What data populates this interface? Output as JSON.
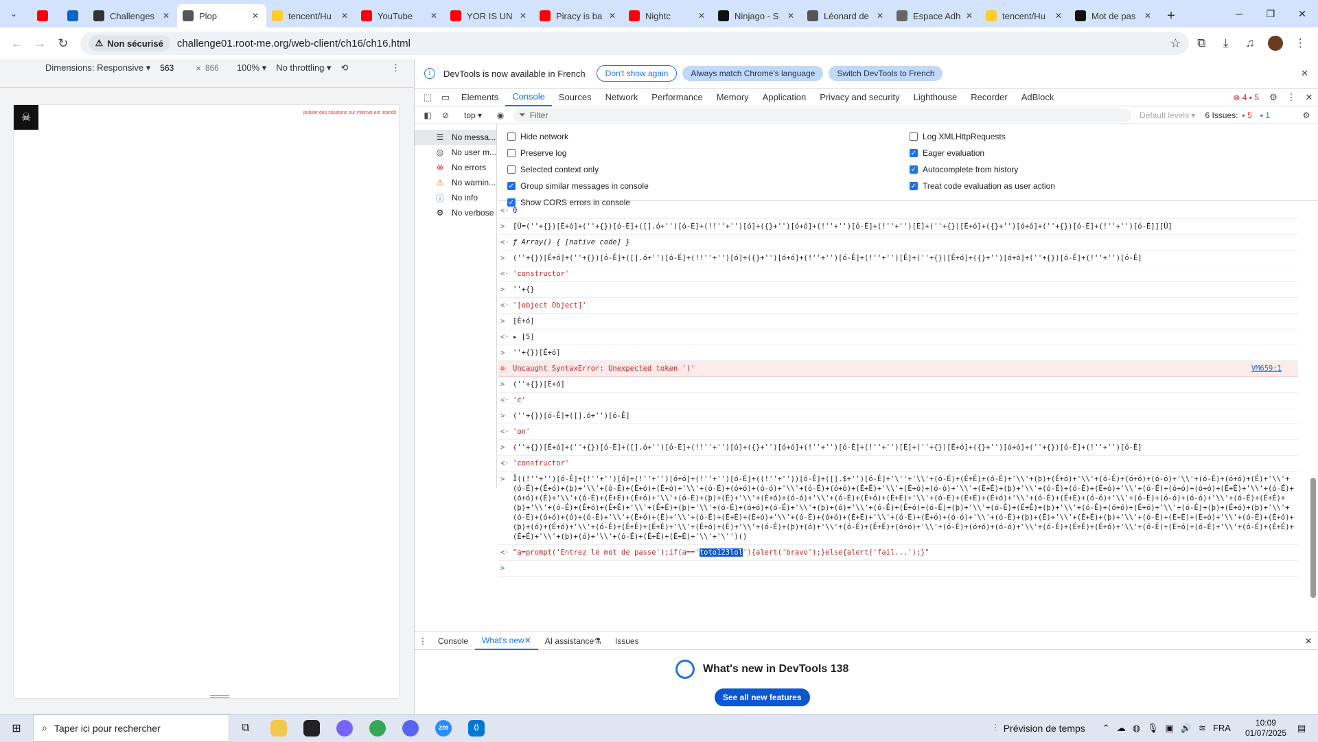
{
  "tabs": [
    {
      "label": "",
      "icon": "youtube-icon",
      "color": "#ff0000",
      "pinned": true
    },
    {
      "label": "",
      "icon": "outlook-icon",
      "color": "#0a64c9",
      "pinned": true
    },
    {
      "label": "Challenges",
      "icon": "root-me-icon",
      "color": "#333333"
    },
    {
      "label": "Plop",
      "icon": "globe-icon",
      "color": "#555555",
      "active": true
    },
    {
      "label": "tencent/Hu",
      "icon": "huggingface-icon",
      "color": "#ffcc33"
    },
    {
      "label": "YouTube",
      "icon": "youtube-icon",
      "color": "#ff0000"
    },
    {
      "label": "YOR IS UN",
      "icon": "youtube-icon",
      "color": "#ff0000"
    },
    {
      "label": "Piracy is ba",
      "icon": "youtube-icon",
      "color": "#ff0000"
    },
    {
      "label": "Nightc",
      "icon": "youtube-icon",
      "color": "#ff0000"
    },
    {
      "label": "Ninjago - S",
      "icon": "tiktok-icon",
      "color": "#111111"
    },
    {
      "label": "Léonard de",
      "icon": "wikipedia-icon",
      "color": "#555555"
    },
    {
      "label": "Espace Adh",
      "icon": "document-icon",
      "color": "#666666"
    },
    {
      "label": "tencent/Hu",
      "icon": "huggingface-icon",
      "color": "#ffcc33"
    },
    {
      "label": "Mot de pas",
      "icon": "openai-icon",
      "color": "#111111"
    }
  ],
  "toolbar": {
    "security_label": "Non sécurisé",
    "url": "challenge01.root-me.org/web-client/ch16/ch16.html"
  },
  "devicebar": {
    "dimensions": "Dimensions: Responsive",
    "width": "563",
    "height": "866",
    "zoom": "100%",
    "throttle": "No throttling"
  },
  "page": {
    "slogan": "publier des solutions sur internet est interdit"
  },
  "devtools": {
    "infobar": {
      "message": "DevTools is now available in French",
      "dont_show": "Don't show again",
      "always_match": "Always match Chrome's language",
      "switch": "Switch DevTools to French"
    },
    "tabs": [
      "Elements",
      "Console",
      "Sources",
      "Network",
      "Performance",
      "Memory",
      "Application",
      "Privacy and security",
      "Lighthouse",
      "Recorder",
      "AdBlock"
    ],
    "error_count": "4",
    "warning_count": "5",
    "context": "top",
    "filter_placeholder": "Filter",
    "levels": "Default levels",
    "issues_label": "6 Issues:",
    "issues_red": "5",
    "issues_blue": "1",
    "sidebar": [
      {
        "label": "No messa...",
        "icon": "list-icon"
      },
      {
        "label": "No user m...",
        "icon": "user-icon"
      },
      {
        "label": "No errors",
        "icon": "error-icon"
      },
      {
        "label": "No warnin...",
        "icon": "warning-icon"
      },
      {
        "label": "No info",
        "icon": "info-icon"
      },
      {
        "label": "No verbose",
        "icon": "gear-icon"
      }
    ],
    "settings_left": [
      {
        "label": "Hide network",
        "checked": false
      },
      {
        "label": "Preserve log",
        "checked": false
      },
      {
        "label": "Selected context only",
        "checked": false
      },
      {
        "label": "Group similar messages in console",
        "checked": true
      },
      {
        "label": "Show CORS errors in console",
        "checked": true
      }
    ],
    "settings_right": [
      {
        "label": "Log XMLHttpRequests",
        "checked": false
      },
      {
        "label": "Eager evaluation",
        "checked": true
      },
      {
        "label": "Autocomplete from history",
        "checked": true
      },
      {
        "label": "Treat code evaluation as user action",
        "checked": true
      }
    ],
    "console": [
      {
        "kind": "num",
        "arrow": "<·",
        "text": "0"
      },
      {
        "kind": "input",
        "arrow": ">",
        "text": "[Û=(''+{})[É+ó]+(''+{})[ó-É]+([].ó+'')[ó-É]+(!!''+'')[ó]+({}+'')[ó+ó]+(!''+'')[ó-É]+(!''+'')[É]+(''+{})[É+ó]+({}+'')[ó+ó]+(''+{})[ó-É]+(!''+'')[ó-É]][Û]"
      },
      {
        "kind": "fn",
        "arrow": "<·",
        "text": "ƒ Array() { [native code] }"
      },
      {
        "kind": "input",
        "arrow": ">",
        "text": "(''+{})[É+ó]+(''+{})[ó-É]+([].ó+'')[ó-É]+(!!''+'')[ó]+({}+'')[ó+ó]+(!''+'')[ó-É]+(!''+'')[É]+(''+{})[É+ó]+({}+'')[ó+ó]+(''+{})[ó-É]+(!''+'')[ó-É]"
      },
      {
        "kind": "str",
        "arrow": "<·",
        "text": "'constructor'"
      },
      {
        "kind": "input",
        "arrow": ">",
        "text": "''+{}"
      },
      {
        "kind": "str",
        "arrow": "<·",
        "text": "'[object Object]'"
      },
      {
        "kind": "input",
        "arrow": ">",
        "text": "[É+ó]"
      },
      {
        "kind": "result",
        "arrow": "<·",
        "text": "▸ [5]"
      },
      {
        "kind": "input",
        "arrow": ">",
        "text": "''+{})[É+ó]"
      },
      {
        "kind": "err",
        "arrow": "⊗",
        "text": "Uncaught SyntaxError: Unexpected token ')'",
        "source": "VM659:1"
      },
      {
        "kind": "input",
        "arrow": ">",
        "text": "(''+{})[É+ó]"
      },
      {
        "kind": "str",
        "arrow": "<·",
        "text": "'c'"
      },
      {
        "kind": "input",
        "arrow": ">",
        "text": "(''+{})[ó-É]+([].ó+'')[ó-É]"
      },
      {
        "kind": "str",
        "arrow": "<·",
        "text": "'on'"
      },
      {
        "kind": "input",
        "arrow": ">",
        "text": "(''+{})[É+ó]+(''+{})[ó-É]+([].ó+'')[ó-É]+(!!''+'')[ó]+({}+'')[ó+ó]+(!''+'')[ó-É]+(!''+'')[É]+(''+{})[É+ó]+({}+'')[ó+ó]+(''+{})[ó-É]+(!''+'')[ó-É]"
      },
      {
        "kind": "str",
        "arrow": "<·",
        "text": "'constructor'"
      },
      {
        "kind": "input",
        "arrow": ">",
        "text": "Î((!''+'')[ó-É]+(!''+'')[ó]+(!''+'')[ó+ó]+(!''+'')[ó-É]+((!''+''))[ó-É]+([].$+'')[ó-É]+'\\''+'\\\\'+(ó-É)+(É+É)+(ó-É)+'\\\\'+(þ)+(É+ó)+'\\\\'+(ó-É)+(ó+ó)+(ó-ó)+'\\\\'+(ó-É)+(ó+ó)+(É)+'\\\\'+(ó-É)+(É+ó)+(þ)+'\\\\'+(ó-É)+(É+ó)+(É+ó)+'\\\\'+(ó-É)+(ó+ó)+(ó-ó)+'\\\\'+(ó-É)+(ó+ó)+(É+É)+'\\\\'+(É+ó)+(ó-ó)+'\\\\'+(É+É)+(þ)+'\\\\'+(ó-É)+(ó-É)+(É+ó)+'\\\\'+(ó-É)+(ó+ó)+(ó+ó)+(É+É)+'\\\\'+(ó-É)+(ó+ó)+(É)+'\\\\'+(ó-É)+(É+É)+(É+ó)+'\\\\'+(ó-É)+(þ)+(É)+'\\\\'+(É+ó)+(ó-ó)+'\\\\'+(ó-É)+(É+ó)+(É+É)+'\\\\'+(ó-É)+(É+É)+(É+ó)+'\\\\'+(ó-É)+(É+É)+(ó-ó)+'\\\\'+(ó-É)+(ó-ó)+(ó-ó)+'\\\\'+(ó-É)+(É+É)+(þ)+'\\\\'+(ó-É)+(É+ó)+(É+É)+'\\\\'+(É+É)+(þ)+'\\\\'+(ó-É)+(ó+ó)+(ó-É)+'\\\\'+(þ)+(ó)+'\\\\'+(ó-É)+(É+ó)+(ó-É)+(þ)+'\\\\'+(ó-É)+(É+É)+(þ)+'\\\\'+(ó-É)+(ó+ó)+(É+ó)+'\\\\'+(ó-É)+(þ)+(É+ó)+(þ)+'\\\\'+(ó-É)+(ó+ó)+(ó)+(ó-É)+'\\\\'+(É+ó)+(É)+'\\\\'+(ó-É)+(É+É)+(É+ó)+'\\\\'+(ó-É)+(ó+ó)+(É+É)+'\\\\'+(ó-É)+(É+ó)+(ó-ó)+'\\\\'+(ó-É)+(þ)+(É)+'\\\\'+(É+É)+(þ)+'\\\\'+(ó-É)+(É+É)+(É+ó)+'\\\\'+(ó-É)+(É+ó)+(þ)+(ó)+(É+ó)+'\\\\'+(ó-É)+(É+É)+(É+É)+'\\\\'+(É+ó)+(É)+'\\\\'+(ó-É)+(þ)+(ó)+'\\\\'+(ó-É)+(É+É)+(ó+ó)+'\\\\'+(ó-É)+(ó+ó)+(ó-ó)+'\\\\'+(ó-É)+(É+É)+(É+ó)+'\\\\'+(ó-É)+(É+ó)+(ó-É)+'\\\\'+(ó-É)+(É+É)+(É+É)+'\\\\'+(þ)+(ó)+'\\\\'+(ó-É)+(É+É)+(É+É)+'\\\\'+'\\'')()"
      },
      {
        "kind": "str",
        "arrow": "<·",
        "text_before": "\"a=prompt('Entrez le mot de passe');if(a=='",
        "highlight": "toto123lol",
        "text_after": "'){alert('bravo');}else{alert('fail...');}\""
      },
      {
        "kind": "prompt",
        "arrow": ">",
        "text": ""
      }
    ],
    "drawer_tabs": [
      "Console",
      "What's new",
      "AI assistance",
      "Issues"
    ],
    "whats_new_title": "What's new in DevTools 138",
    "whats_new_button": "See all new features"
  },
  "taskbar": {
    "search_placeholder": "Taper ici pour rechercher",
    "weather": "Prévision de temps",
    "language": "FRA",
    "time": "10:09",
    "date": "01/07/2025"
  }
}
